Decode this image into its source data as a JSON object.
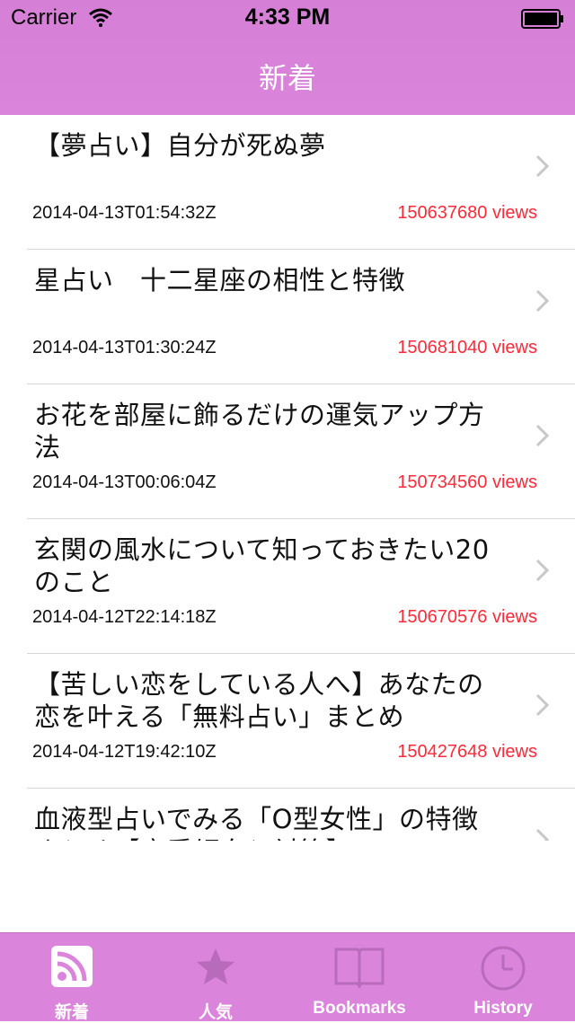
{
  "status_bar": {
    "carrier": "Carrier",
    "time": "4:33 PM"
  },
  "nav": {
    "title": "新着"
  },
  "articles": [
    {
      "title": "【夢占い】自分が死ぬ夢",
      "date": "2014-04-13T01:54:32Z",
      "views": "150637680 views"
    },
    {
      "title": "星占い　十二星座の相性と特徴",
      "date": "2014-04-13T01:30:24Z",
      "views": "150681040 views"
    },
    {
      "title": "お花を部屋に飾るだけの運気アップ方法",
      "date": "2014-04-13T00:06:04Z",
      "views": "150734560 views"
    },
    {
      "title": "玄関の風水について知っておきたい20のこと",
      "date": "2014-04-12T22:14:18Z",
      "views": "150670576 views"
    },
    {
      "title": "【苦しい恋をしている人へ】あなたの恋を叶える「無料占い」まとめ",
      "date": "2014-04-12T19:42:10Z",
      "views": "150427648 views"
    },
    {
      "title": "血液型占いでみる「O型女性」の特徴まとめ【恋愛傾向と対策】",
      "date": "",
      "views": ""
    }
  ],
  "tabs": [
    {
      "label": "新着",
      "icon": "rss-icon"
    },
    {
      "label": "人気",
      "icon": "star-icon"
    },
    {
      "label": "Bookmarks",
      "icon": "book-icon"
    },
    {
      "label": "History",
      "icon": "clock-icon"
    }
  ],
  "colors": {
    "header": "#d57fd6",
    "tabbar": "#db84dc",
    "views": "#ff2a3a",
    "tab_inactive": "#b86bba"
  }
}
